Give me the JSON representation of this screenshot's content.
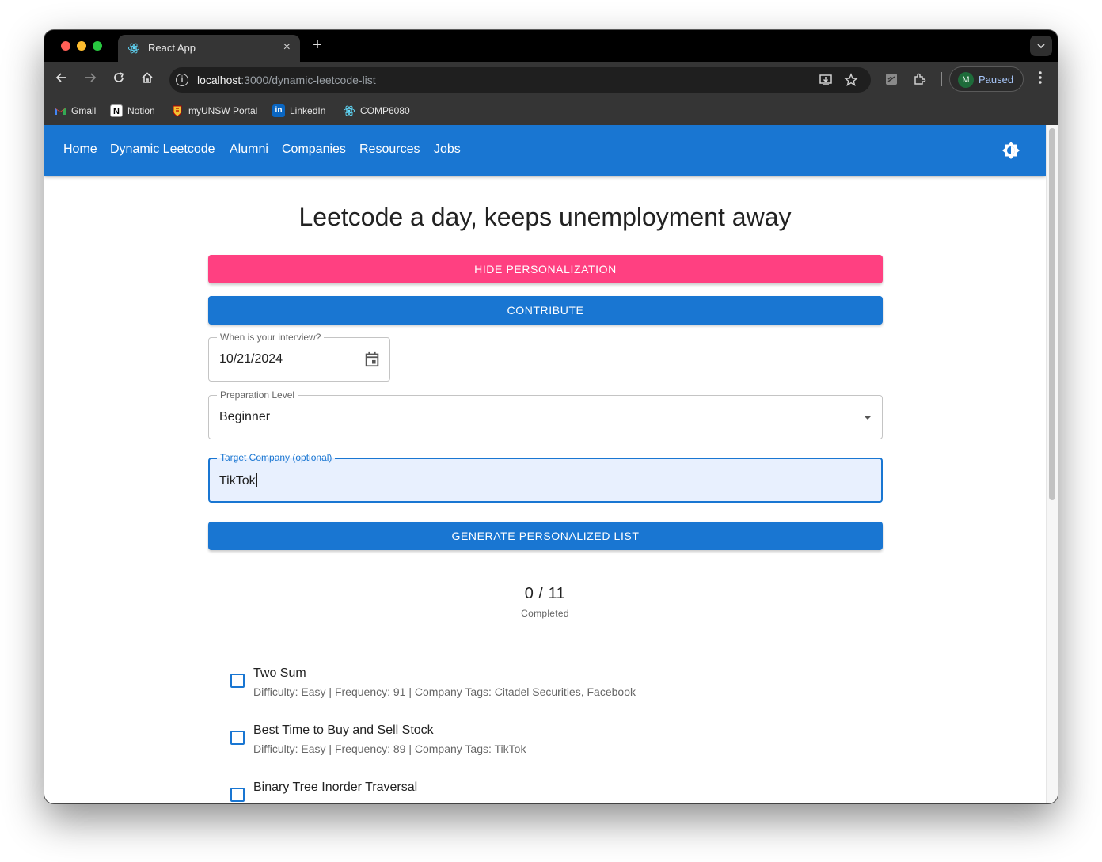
{
  "browser": {
    "tab_title": "React App",
    "tab_close": "×",
    "new_tab": "+",
    "url_host": "localhost",
    "url_path": ":3000/dynamic-leetcode-list",
    "profile_initial": "M",
    "profile_label": "Paused"
  },
  "bookmarks": [
    {
      "label": "Gmail",
      "icon": "gmail-icon"
    },
    {
      "label": "Notion",
      "icon": "notion-icon"
    },
    {
      "label": "myUNSW Portal",
      "icon": "unsw-icon"
    },
    {
      "label": "LinkedIn",
      "icon": "linkedin-icon"
    },
    {
      "label": "COMP6080",
      "icon": "react-icon"
    }
  ],
  "navbar": {
    "links": [
      "Home",
      "Dynamic Leetcode",
      "Alumni",
      "Companies",
      "Resources",
      "Jobs"
    ],
    "color": "#1976d2"
  },
  "page": {
    "title": "Leetcode a day, keeps unemployment away",
    "hide_button": "HIDE PERSONALIZATION",
    "contribute_button": "CONTRIBUTE",
    "generate_button": "GENERATE PERSONALIZED LIST"
  },
  "form": {
    "interview_label": "When is your interview?",
    "interview_date": "10/21/2024",
    "level_label": "Preparation Level",
    "level_value": "Beginner",
    "company_label": "Target Company (optional)",
    "company_value": "TikTok"
  },
  "progress": {
    "completed": 0,
    "total": 11,
    "count_text": "0 / 11",
    "label": "Completed"
  },
  "problems": [
    {
      "title": "Two Sum",
      "meta": "Difficulty: Easy | Frequency: 91 | Company Tags: Citadel Securities, Facebook",
      "checked": false
    },
    {
      "title": "Best Time to Buy and Sell Stock",
      "meta": "Difficulty: Easy | Frequency: 89 | Company Tags: TikTok",
      "checked": false
    },
    {
      "title": "Binary Tree Inorder Traversal",
      "meta": "",
      "checked": false
    }
  ],
  "colors": {
    "primary": "#1976d2",
    "secondary": "#ff4081",
    "focused_input_bg": "#e8f0fe"
  }
}
